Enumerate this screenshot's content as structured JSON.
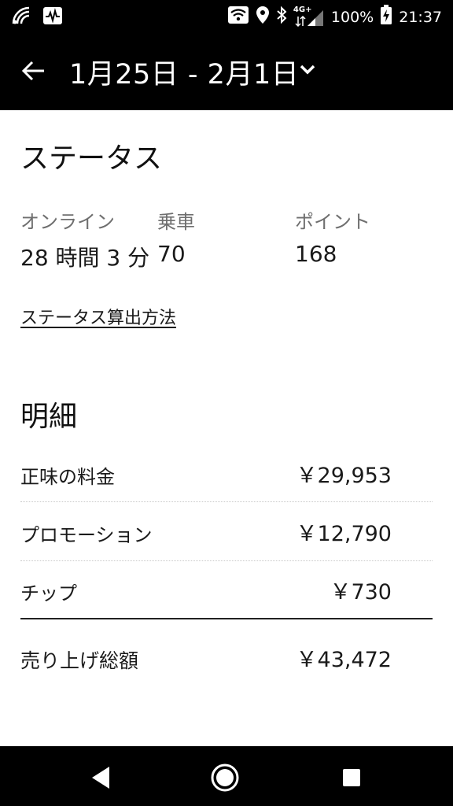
{
  "status_bar": {
    "network_label": "4G+",
    "battery": "100%",
    "time": "21:37"
  },
  "app_bar": {
    "date_range": "1月25日 - 2月1日"
  },
  "status_section": {
    "title": "ステータス",
    "stats": [
      {
        "label": "オンライン",
        "value": "28 時間 3 分"
      },
      {
        "label": "乗車",
        "value": "70"
      },
      {
        "label": "ポイント",
        "value": "168"
      }
    ],
    "link_label": "ステータス算出方法"
  },
  "breakdown": {
    "title": "明細",
    "rows": [
      {
        "label": "正味の料金",
        "value": "￥29,953"
      },
      {
        "label": "プロモーション",
        "value": "￥12,790"
      },
      {
        "label": "チップ",
        "value": "￥730"
      }
    ],
    "total": {
      "label": "売り上げ総額",
      "value": "￥43,472"
    }
  },
  "nav": {
    "back_icon": "triangle-back-icon",
    "home_icon": "circle-home-icon",
    "recents_icon": "square-recents-icon"
  }
}
